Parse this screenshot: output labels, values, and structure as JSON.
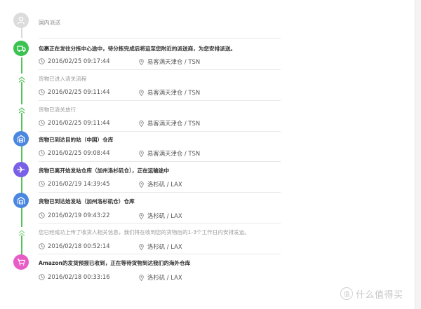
{
  "header": {
    "label": "国内派送",
    "status_icon": "person-icon"
  },
  "events": [
    {
      "title": "包裹正在发往分拣中心途中，待分拣完成后将运至您附近的派送商，为您安排派送。",
      "time": "2016/02/25 09:17:44",
      "location": "易客满天津仓 / TSN",
      "icon": "truck-icon",
      "color": "#3cc251",
      "emphasis": true
    },
    {
      "title": "货物已进入清关流程",
      "time": "2016/02/25 09:11:44",
      "location": "易客满天津仓 / TSN",
      "icon": "chevron-up-icon",
      "color": "#56c15e",
      "emphasis": false
    },
    {
      "title": "货物已清关放行",
      "time": "2016/02/25 09:11:44",
      "location": "易客满天津仓 / TSN",
      "icon": "chevron-up-icon",
      "color": "#56c15e",
      "emphasis": false
    },
    {
      "title": "货物已到达目的站（中国）仓库",
      "time": "2016/02/25 09:08:44",
      "location": "易客满天津仓 / TSN",
      "icon": "warehouse-icon",
      "color": "#4b86e0",
      "emphasis": true
    },
    {
      "title": "货物已离开始发站仓库（加州洛杉矶仓），正在运输途中",
      "time": "2016/02/19 14:39:45",
      "location": "洛杉矶 / LAX",
      "icon": "airplane-icon",
      "color": "#7a60e6",
      "emphasis": true
    },
    {
      "title": "货物已到达始发站（加州洛杉矶仓）仓库",
      "time": "2016/02/19 09:43:22",
      "location": "洛杉矶 / LAX",
      "icon": "warehouse-icon",
      "color": "#4b86e0",
      "emphasis": true
    },
    {
      "title": "您已经成功上传了收货人相关信息，我们将在收到您的货物后的1-3个工作日内安排发运。",
      "time": "2016/02/18 00:52:14",
      "location": "洛杉矶 / LAX",
      "icon": "chevron-up-icon",
      "color": "#8fd696",
      "emphasis": false
    },
    {
      "title": "Amazon的发货预报已收到，正在等待货物到达我们的海外仓库",
      "time": "2016/02/18 00:33:16",
      "location": "洛杉矶 / LAX",
      "icon": "cart-icon",
      "color": "#e85cc6",
      "emphasis": true
    }
  ],
  "watermark": {
    "badge": "值",
    "text": "什么值得买"
  }
}
